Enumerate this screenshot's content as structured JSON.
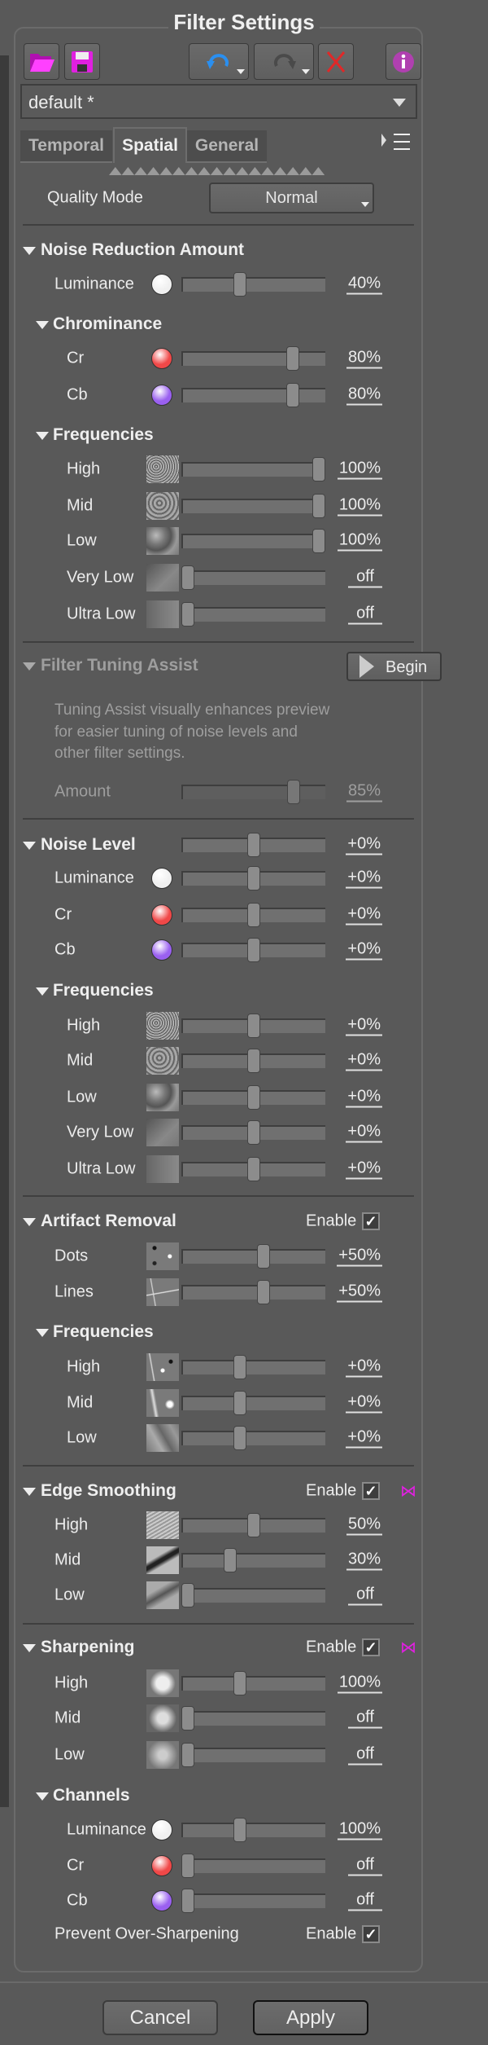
{
  "title": "Filter Settings",
  "toolbar": {
    "icons": [
      "open-folder-icon",
      "save-disk-icon",
      "undo-icon",
      "redo-icon",
      "reset-x-icon",
      "info-icon"
    ]
  },
  "preset": {
    "value": "default *"
  },
  "tabs": [
    {
      "label": "Temporal",
      "active": false
    },
    {
      "label": "Spatial",
      "active": true
    },
    {
      "label": "General",
      "active": false
    }
  ],
  "quality": {
    "label": "Quality Mode",
    "value": "Normal"
  },
  "colors": {
    "luminance": "#f0f0f0",
    "cr": "#f04848",
    "cb": "#9a60f0",
    "accent": "#e020e0"
  },
  "rows": [
    {
      "kind": "quality"
    },
    {
      "kind": "div"
    },
    {
      "kind": "h",
      "label": "Noise Reduction Amount"
    },
    {
      "kind": "s",
      "label": "Luminance",
      "icon": "luminance",
      "value": "40%",
      "level": 0.4,
      "indent": 1
    },
    {
      "kind": "sh",
      "label": "Chrominance"
    },
    {
      "kind": "s",
      "label": "Cr",
      "icon": "cr",
      "value": "80%",
      "level": 0.8,
      "indent": 2
    },
    {
      "kind": "s",
      "label": "Cb",
      "icon": "cb",
      "value": "80%",
      "level": 0.8,
      "indent": 2
    },
    {
      "kind": "sh",
      "label": "Frequencies"
    },
    {
      "kind": "s",
      "label": "High",
      "icon": "freq-high",
      "value": "100%",
      "level": 1,
      "indent": 2
    },
    {
      "kind": "s",
      "label": "Mid",
      "icon": "freq-mid",
      "value": "100%",
      "level": 1,
      "indent": 2
    },
    {
      "kind": "s",
      "label": "Low",
      "icon": "freq-low",
      "value": "100%",
      "level": 1,
      "indent": 2
    },
    {
      "kind": "s",
      "label": "Very Low",
      "icon": "freq-verylow",
      "value": "off",
      "level": 0,
      "indent": 2
    },
    {
      "kind": "s",
      "label": "Ultra Low",
      "icon": "freq-ultralow",
      "value": "off",
      "level": 0,
      "indent": 2
    },
    {
      "kind": "div"
    },
    {
      "kind": "fta",
      "label": "Filter Tuning Assist",
      "button": "Begin"
    },
    {
      "kind": "text",
      "lines": [
        "Tuning Assist visually enhances preview",
        "for easier tuning of noise levels and",
        "other filter settings."
      ]
    },
    {
      "kind": "s",
      "label": "Amount",
      "value": "85%",
      "level": 0.81,
      "indent": 1,
      "dim": true
    },
    {
      "kind": "div"
    },
    {
      "kind": "hs",
      "label": "Noise Level",
      "value": "+0%",
      "level": 0.5
    },
    {
      "kind": "s",
      "label": "Luminance",
      "icon": "luminance",
      "value": "+0%",
      "level": 0.5,
      "indent": 1
    },
    {
      "kind": "s",
      "label": "Cr",
      "icon": "cr",
      "value": "+0%",
      "level": 0.5,
      "indent": 1
    },
    {
      "kind": "s",
      "label": "Cb",
      "icon": "cb",
      "value": "+0%",
      "level": 0.5,
      "indent": 1
    },
    {
      "kind": "sh",
      "label": "Frequencies"
    },
    {
      "kind": "s",
      "label": "High",
      "icon": "freq-high",
      "value": "+0%",
      "level": 0.5,
      "indent": 2
    },
    {
      "kind": "s",
      "label": "Mid",
      "icon": "freq-mid",
      "value": "+0%",
      "level": 0.5,
      "indent": 2
    },
    {
      "kind": "s",
      "label": "Low",
      "icon": "freq-low",
      "value": "+0%",
      "level": 0.5,
      "indent": 2
    },
    {
      "kind": "s",
      "label": "Very Low",
      "icon": "freq-verylow",
      "value": "+0%",
      "level": 0.5,
      "indent": 2
    },
    {
      "kind": "s",
      "label": "Ultra Low",
      "icon": "freq-ultralow",
      "value": "+0%",
      "level": 0.5,
      "indent": 2
    },
    {
      "kind": "div"
    },
    {
      "kind": "he",
      "label": "Artifact Removal",
      "enable": "Enable",
      "checked": true
    },
    {
      "kind": "s",
      "label": "Dots",
      "icon": "artifact-dots",
      "value": "+50%",
      "level": 0.58,
      "indent": 1
    },
    {
      "kind": "s",
      "label": "Lines",
      "icon": "artifact-lines",
      "value": "+50%",
      "level": 0.58,
      "indent": 1
    },
    {
      "kind": "sh",
      "label": "Frequencies"
    },
    {
      "kind": "s",
      "label": "High",
      "icon": "artifact-high",
      "value": "+0%",
      "level": 0.4,
      "indent": 2
    },
    {
      "kind": "s",
      "label": "Mid",
      "icon": "artifact-mid",
      "value": "+0%",
      "level": 0.4,
      "indent": 2
    },
    {
      "kind": "s",
      "label": "Low",
      "icon": "artifact-low",
      "value": "+0%",
      "level": 0.4,
      "indent": 2
    },
    {
      "kind": "div"
    },
    {
      "kind": "he",
      "label": "Edge Smoothing",
      "enable": "Enable",
      "checked": true,
      "bowtie": true
    },
    {
      "kind": "s",
      "label": "High",
      "icon": "edge-high",
      "value": "50%",
      "level": 0.5,
      "indent": 1
    },
    {
      "kind": "s",
      "label": "Mid",
      "icon": "edge-mid",
      "value": "30%",
      "level": 0.32,
      "indent": 1
    },
    {
      "kind": "s",
      "label": "Low",
      "icon": "edge-low",
      "value": "off",
      "level": 0,
      "indent": 1
    },
    {
      "kind": "div"
    },
    {
      "kind": "he",
      "label": "Sharpening",
      "enable": "Enable",
      "checked": true,
      "bowtie": true
    },
    {
      "kind": "s",
      "label": "High",
      "icon": "sharpen-high",
      "value": "100%",
      "level": 0.4,
      "indent": 1
    },
    {
      "kind": "s",
      "label": "Mid",
      "icon": "sharpen-mid",
      "value": "off",
      "level": 0,
      "indent": 1
    },
    {
      "kind": "s",
      "label": "Low",
      "icon": "sharpen-low",
      "value": "off",
      "level": 0,
      "indent": 1
    },
    {
      "kind": "sh",
      "label": "Channels"
    },
    {
      "kind": "s",
      "label": "Luminance",
      "icon": "luminance",
      "value": "100%",
      "level": 0.4,
      "indent": 2
    },
    {
      "kind": "s",
      "label": "Cr",
      "icon": "cr",
      "value": "off",
      "level": 0,
      "indent": 2
    },
    {
      "kind": "s",
      "label": "Cb",
      "icon": "cb",
      "value": "off",
      "level": 0,
      "indent": 2
    },
    {
      "kind": "le",
      "label": "Prevent Over-Sharpening",
      "enable": "Enable",
      "checked": true
    }
  ],
  "footer": {
    "cancel": "Cancel",
    "apply": "Apply"
  }
}
